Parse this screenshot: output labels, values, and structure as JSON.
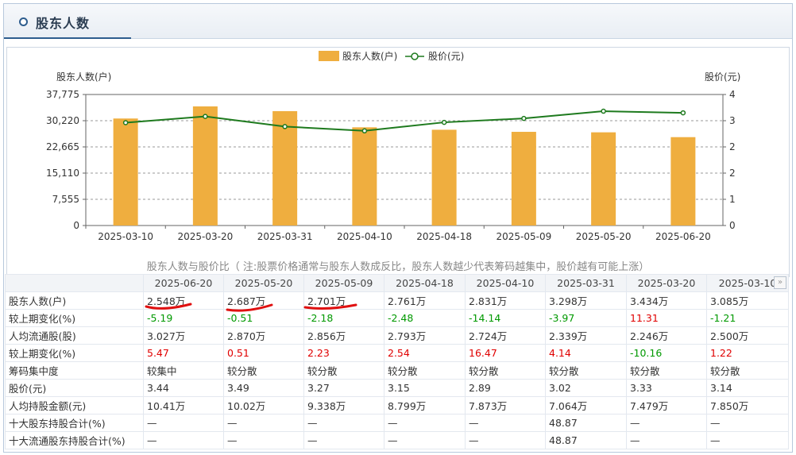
{
  "header": {
    "title": "股东人数"
  },
  "legend": {
    "bar": "股东人数(户)",
    "line": "股价(元)"
  },
  "axis": {
    "left_title": "股东人数(户)",
    "right_title": "股价(元)"
  },
  "subtitle": "股东人数与股价比（ 注:股票价格通常与股东人数成反比，股东人数越少代表筹码越集中，股价越有可能上涨）",
  "colors": {
    "bar": "#EFAE3F",
    "line": "#1E7A1E",
    "red": "#E00000",
    "green": "#009900"
  },
  "chart_data": {
    "type": "bar",
    "categories": [
      "2025-03-10",
      "2025-03-20",
      "2025-03-31",
      "2025-04-10",
      "2025-04-18",
      "2025-05-09",
      "2025-05-20",
      "2025-06-20"
    ],
    "series": [
      {
        "name": "股东人数(户)",
        "type": "bar",
        "axis": "left",
        "values": [
          30850,
          34340,
          32980,
          28310,
          27610,
          27010,
          26870,
          25480
        ]
      },
      {
        "name": "股价(元)",
        "type": "line",
        "axis": "right",
        "values": [
          3.14,
          3.33,
          3.02,
          2.89,
          3.15,
          3.27,
          3.49,
          3.44
        ]
      }
    ],
    "y_left": {
      "min": 0,
      "max": 37775,
      "ticks": [
        "0",
        "7,555",
        "15,110",
        "22,665",
        "30,220",
        "37,775"
      ]
    },
    "y_right": {
      "min": 0,
      "max": 4,
      "ticks": [
        "0",
        "1",
        "2",
        "2",
        "3",
        "4"
      ]
    },
    "grid": true,
    "legend_position": "top-center"
  },
  "table": {
    "columns": [
      "2025-06-20",
      "2025-05-20",
      "2025-05-09",
      "2025-04-18",
      "2025-04-10",
      "2025-03-31",
      "2025-03-20",
      "2025-03-10"
    ],
    "rows": [
      {
        "label": "股东人数(户)",
        "values": [
          "2.548万",
          "2.687万",
          "2.701万",
          "2.761万",
          "2.831万",
          "3.298万",
          "3.434万",
          "3.085万"
        ],
        "tones": [
          "",
          "",
          "",
          "",
          "",
          "",
          "",
          ""
        ]
      },
      {
        "label": "较上期变化(%)",
        "values": [
          "-5.19",
          "-0.51",
          "-2.18",
          "-2.48",
          "-14.14",
          "-3.97",
          "11.31",
          "-1.21"
        ],
        "tones": [
          "green",
          "green",
          "green",
          "green",
          "green",
          "green",
          "red",
          "green"
        ]
      },
      {
        "label": "人均流通股(股)",
        "values": [
          "3.027万",
          "2.870万",
          "2.856万",
          "2.793万",
          "2.724万",
          "2.339万",
          "2.246万",
          "2.500万"
        ],
        "tones": [
          "",
          "",
          "",
          "",
          "",
          "",
          "",
          ""
        ]
      },
      {
        "label": "较上期变化(%)",
        "values": [
          "5.47",
          "0.51",
          "2.23",
          "2.54",
          "16.47",
          "4.14",
          "-10.16",
          "1.22"
        ],
        "tones": [
          "red",
          "red",
          "red",
          "red",
          "red",
          "red",
          "green",
          "red"
        ]
      },
      {
        "label": "筹码集中度",
        "values": [
          "较集中",
          "较分散",
          "较分散",
          "较分散",
          "较分散",
          "较分散",
          "较分散",
          "较分散"
        ],
        "tones": [
          "",
          "",
          "",
          "",
          "",
          "",
          "",
          ""
        ]
      },
      {
        "label": "股价(元)",
        "values": [
          "3.44",
          "3.49",
          "3.27",
          "3.15",
          "2.89",
          "3.02",
          "3.33",
          "3.14"
        ],
        "tones": [
          "",
          "",
          "",
          "",
          "",
          "",
          "",
          ""
        ]
      },
      {
        "label": "人均持股金额(元)",
        "values": [
          "10.41万",
          "10.02万",
          "9.338万",
          "8.799万",
          "7.873万",
          "7.064万",
          "7.479万",
          "7.850万"
        ],
        "tones": [
          "",
          "",
          "",
          "",
          "",
          "",
          "",
          ""
        ]
      },
      {
        "label": "十大股东持股合计(%)",
        "values": [
          "—",
          "—",
          "—",
          "—",
          "—",
          "48.87",
          "—",
          "—"
        ],
        "tones": [
          "",
          "",
          "",
          "",
          "",
          "",
          "",
          ""
        ]
      },
      {
        "label": "十大流通股东持股合计(%)",
        "values": [
          "—",
          "—",
          "—",
          "—",
          "—",
          "48.87",
          "—",
          "—"
        ],
        "tones": [
          "",
          "",
          "",
          "",
          "",
          "",
          "",
          ""
        ]
      }
    ]
  },
  "scroll_icon": "»"
}
